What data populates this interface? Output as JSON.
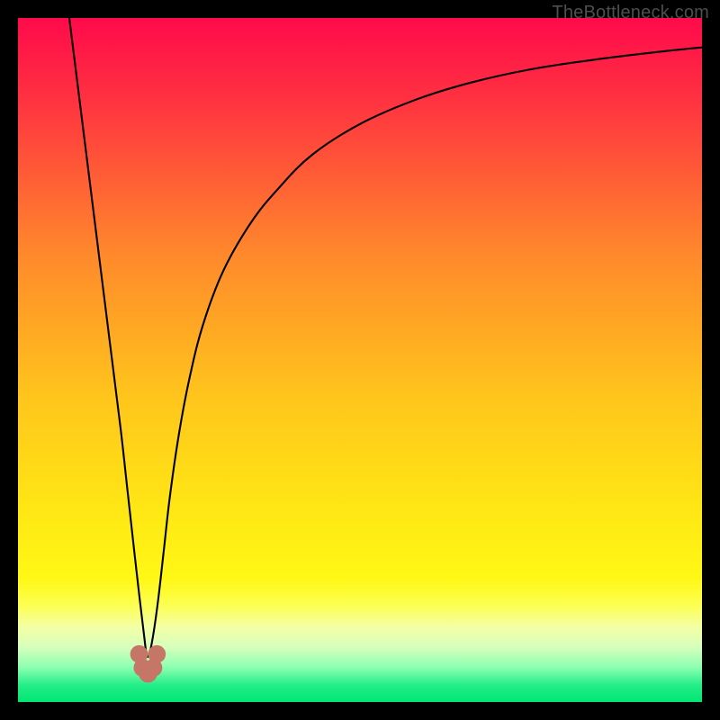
{
  "watermark": "TheBottleneck.com",
  "chart_data": {
    "type": "line",
    "title": "",
    "xlabel": "",
    "ylabel": "",
    "xlim": [
      0,
      100
    ],
    "ylim": [
      0,
      100
    ],
    "background_gradient": {
      "stops": [
        {
          "offset": 0.0,
          "color": "#ff0a4b"
        },
        {
          "offset": 0.12,
          "color": "#ff3240"
        },
        {
          "offset": 0.35,
          "color": "#ff8a2b"
        },
        {
          "offset": 0.55,
          "color": "#ffc41c"
        },
        {
          "offset": 0.72,
          "color": "#ffe714"
        },
        {
          "offset": 0.82,
          "color": "#fff815"
        },
        {
          "offset": 0.86,
          "color": "#fcff55"
        },
        {
          "offset": 0.89,
          "color": "#f4ffa5"
        },
        {
          "offset": 0.92,
          "color": "#d6ffbc"
        },
        {
          "offset": 0.95,
          "color": "#8affb0"
        },
        {
          "offset": 0.975,
          "color": "#25ee88"
        },
        {
          "offset": 1.0,
          "color": "#00e673"
        }
      ]
    },
    "series": [
      {
        "name": "bottleneck-curve",
        "color": "#000000",
        "stroke_width": 2.1,
        "x": [
          7.5,
          9,
          10.5,
          12,
          13.5,
          15,
          16,
          17,
          17.8,
          18.4,
          18.8,
          19.2,
          19.8,
          20.5,
          21.3,
          22.2,
          23.5,
          25,
          27,
          30,
          34,
          38,
          43,
          50,
          58,
          66,
          75,
          85,
          95,
          100
        ],
        "y": [
          100,
          88,
          76,
          64,
          52,
          40,
          31,
          22,
          15,
          10,
          7,
          7,
          10,
          15,
          22,
          30,
          39,
          47,
          55,
          63,
          70,
          75,
          80,
          84.5,
          88,
          90.5,
          92.5,
          94,
          95.2,
          95.7
        ]
      }
    ],
    "markers": [
      {
        "name": "valley-point-a",
        "x": 17.7,
        "y": 7.0,
        "r": 1.9,
        "color": "#c57666"
      },
      {
        "name": "valley-point-b",
        "x": 18.2,
        "y": 5.0,
        "r": 1.9,
        "color": "#c57666"
      },
      {
        "name": "valley-point-c",
        "x": 19.0,
        "y": 4.2,
        "r": 2.0,
        "color": "#c57666"
      },
      {
        "name": "valley-point-d",
        "x": 19.8,
        "y": 5.0,
        "r": 1.9,
        "color": "#c57666"
      },
      {
        "name": "valley-point-e",
        "x": 20.3,
        "y": 7.0,
        "r": 1.9,
        "color": "#c57666"
      }
    ]
  }
}
